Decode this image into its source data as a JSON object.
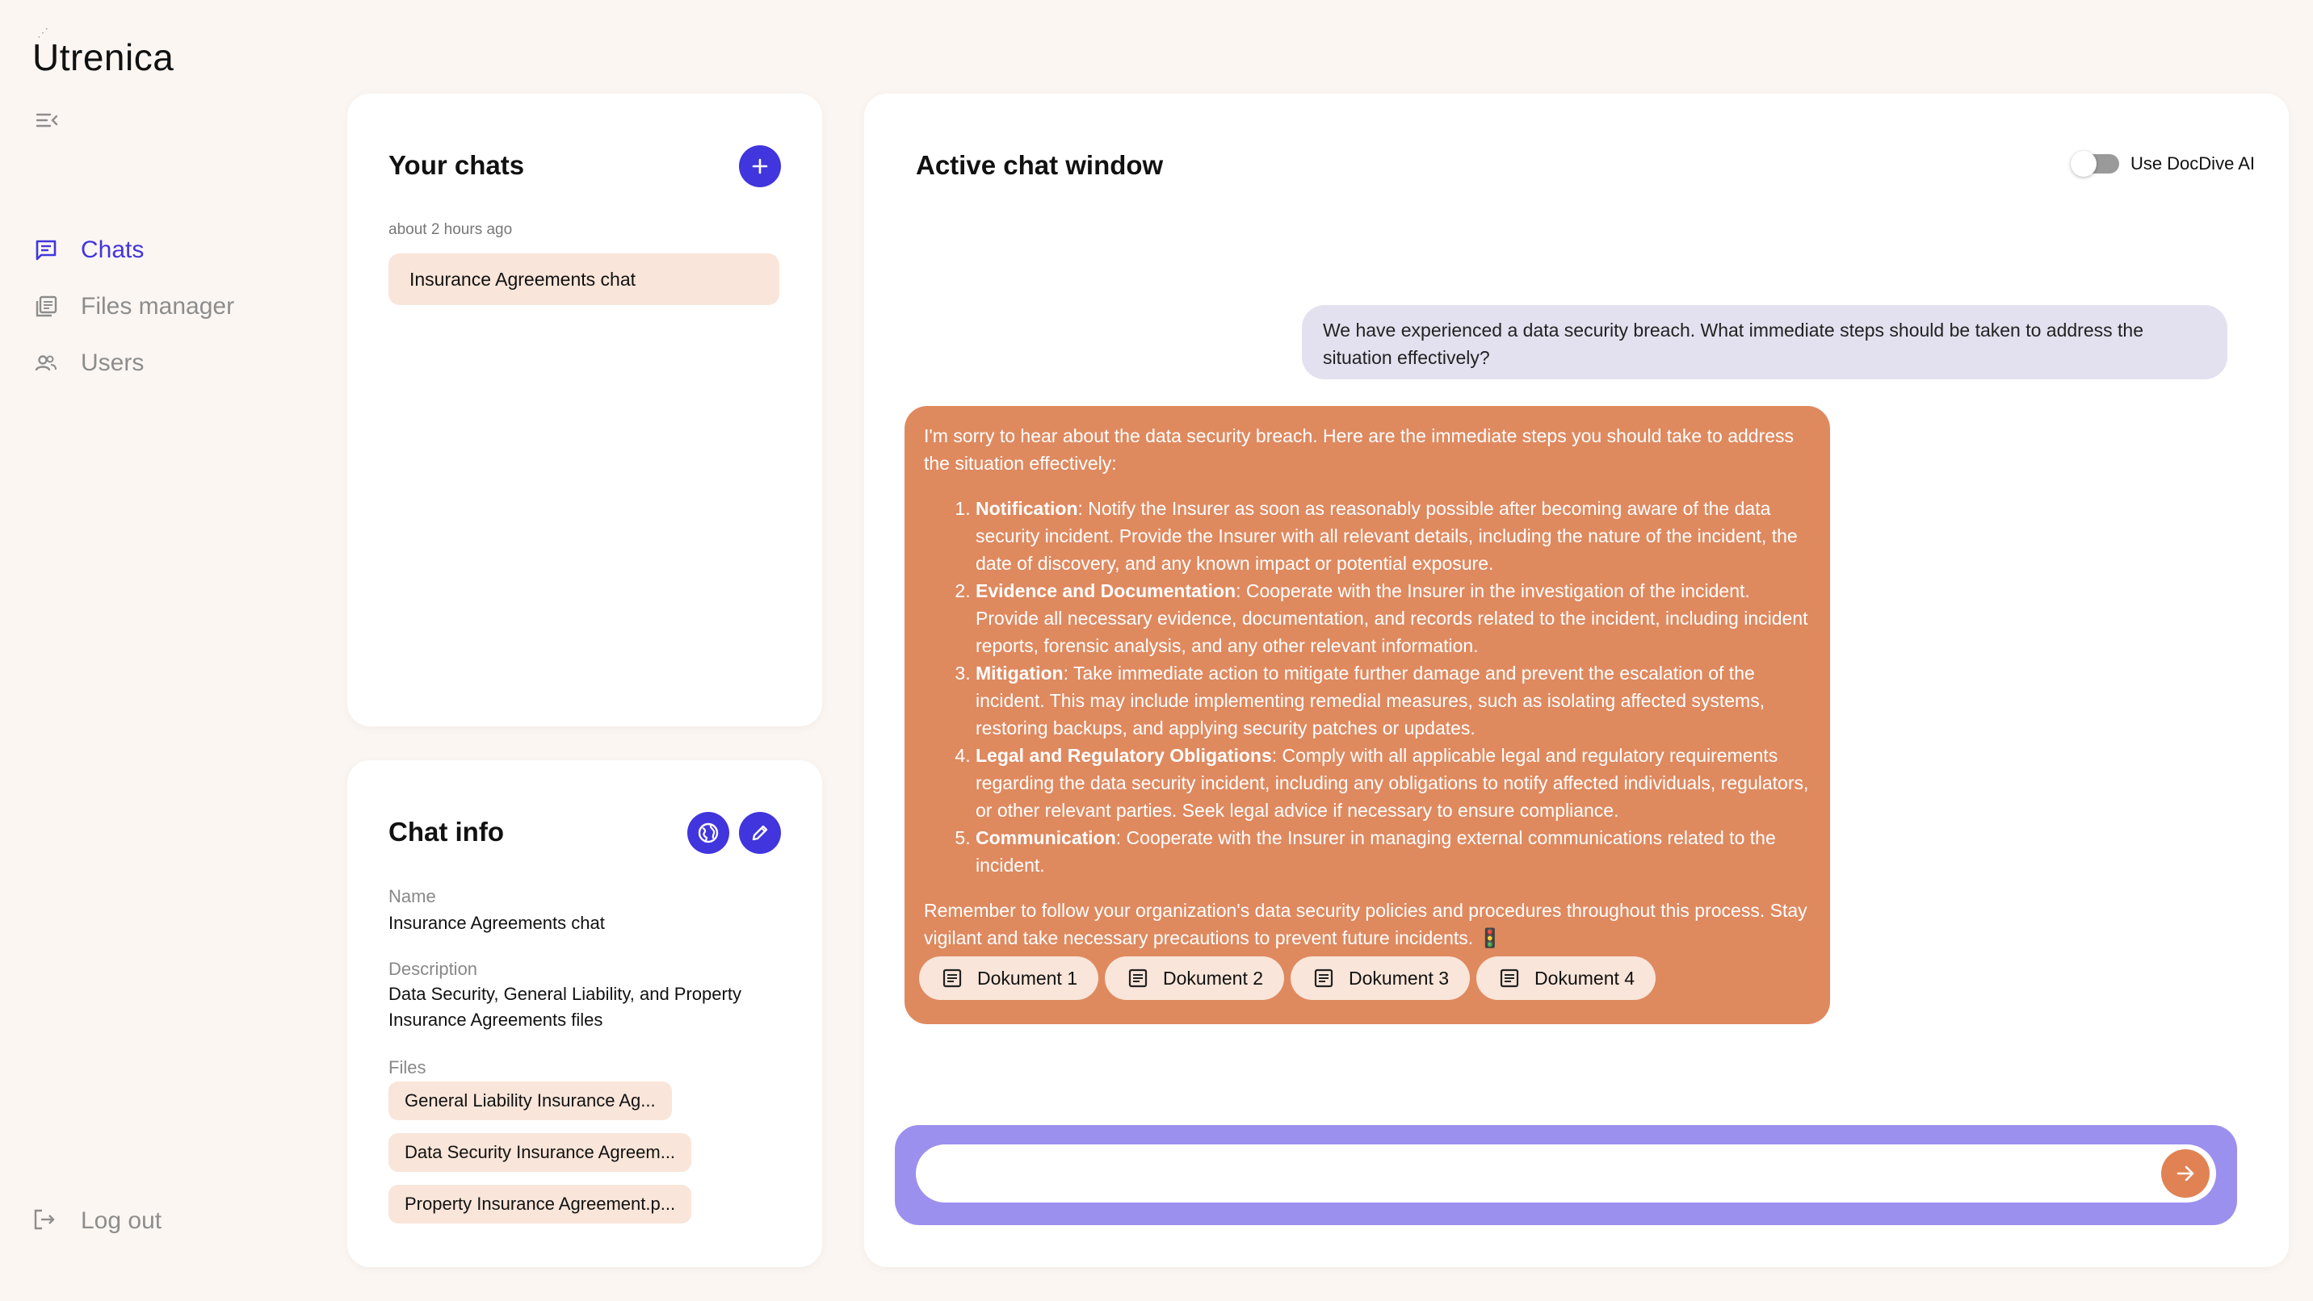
{
  "app": {
    "name": "Utrenica"
  },
  "sidebar": {
    "items": [
      {
        "label": "Chats",
        "icon": "chat-icon",
        "active": true
      },
      {
        "label": "Files manager",
        "icon": "files-icon",
        "active": false
      },
      {
        "label": "Users",
        "icon": "users-icon",
        "active": false
      }
    ],
    "logout_label": "Log out"
  },
  "chats_panel": {
    "title": "Your chats",
    "time_label": "about 2 hours ago",
    "chat_name": "Insurance Agreements chat"
  },
  "chat_info": {
    "title": "Chat info",
    "name_label": "Name",
    "name_value": "Insurance Agreements chat",
    "description_label": "Description",
    "description_value": "Data Security, General Liability, and Property Insurance Agreements files",
    "files_label": "Files",
    "files": [
      "General Liability Insurance Ag...",
      "Data Security Insurance Agreem...",
      "Property Insurance Agreement.p..."
    ]
  },
  "active_chat": {
    "title": "Active chat window",
    "toggle_label": "Use DocDive AI",
    "user_message": "We have experienced a data security breach. What immediate steps should be taken to address the situation effectively?",
    "bot_intro": "I'm sorry to hear about the data security breach. Here are the immediate steps you should take to address the situation effectively:",
    "steps": [
      {
        "title": "Notification",
        "text": ": Notify the Insurer as soon as reasonably possible after becoming aware of the data security incident. Provide the Insurer with all relevant details, including the nature of the incident, the date of discovery, and any known impact or potential exposure."
      },
      {
        "title": "Evidence and Documentation",
        "text": ": Cooperate with the Insurer in the investigation of the incident. Provide all necessary evidence, documentation, and records related to the incident, including incident reports, forensic analysis, and any other relevant information."
      },
      {
        "title": "Mitigation",
        "text": ": Take immediate action to mitigate further damage and prevent the escalation of the incident. This may include implementing remedial measures, such as isolating affected systems, restoring backups, and applying security patches or updates."
      },
      {
        "title": "Legal and Regulatory Obligations",
        "text": ": Comply with all applicable legal and regulatory requirements regarding the data security incident, including any obligations to notify affected individuals, regulators, or other relevant parties. Seek legal advice if necessary to ensure compliance."
      },
      {
        "title": "Communication",
        "text": ": Cooperate with the Insurer in managing external communications related to the incident."
      }
    ],
    "bot_outro": "Remember to follow your organization's data security policies and procedures throughout this process. Stay vigilant and take necessary precautions to prevent future incidents. 🚦",
    "documents": [
      "Dokument 1",
      "Dokument 2",
      "Dokument 3",
      "Dokument 4"
    ],
    "input_placeholder": ""
  },
  "colors": {
    "accent": "#4135dd",
    "bot_bubble": "#df895f",
    "user_bubble": "#e3e1ef",
    "chip": "#f9e5d9",
    "composer": "#9c90ee",
    "send": "#e08254"
  }
}
